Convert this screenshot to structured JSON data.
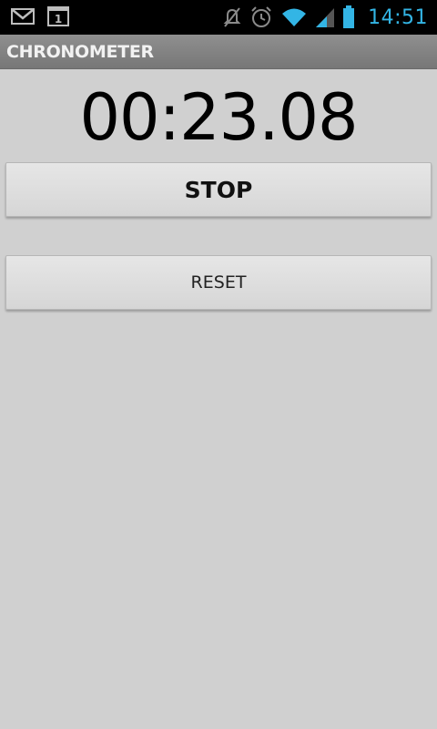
{
  "status_bar": {
    "time": "14:51",
    "notification_badge": "1",
    "icons": [
      "gmail-icon",
      "calendar-icon",
      "mute-icon",
      "alarm-icon",
      "wifi-icon",
      "signal-icon",
      "battery-icon"
    ],
    "accent_color": "#33b5e5"
  },
  "app": {
    "title": "CHRONOMETER"
  },
  "chronometer": {
    "display": "00:23.08"
  },
  "buttons": {
    "stop_label": "STOP",
    "reset_label": "RESET"
  }
}
